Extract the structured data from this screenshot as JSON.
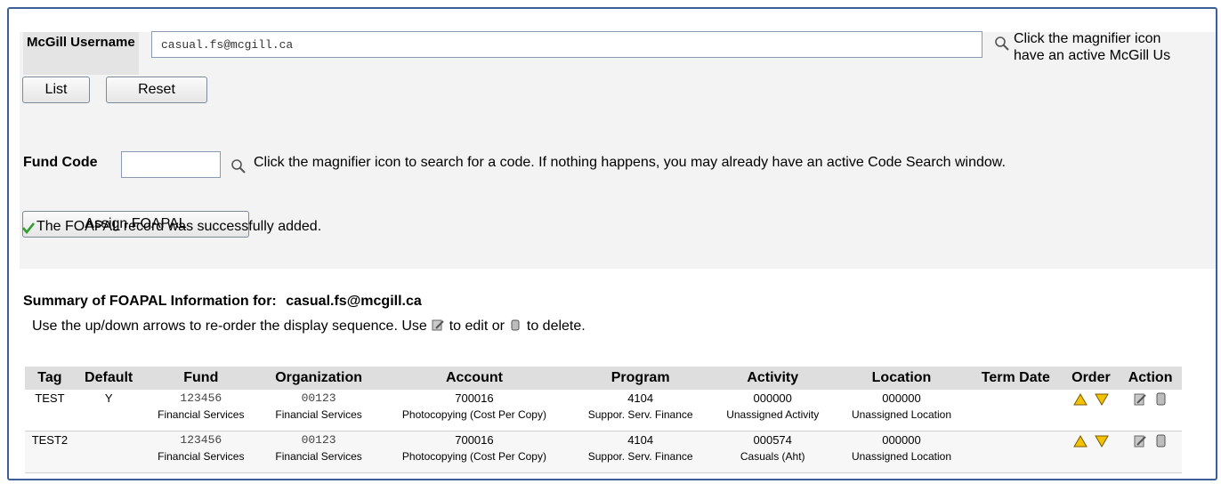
{
  "username": {
    "label": "McGill Username",
    "value": "casual.fs@mcgill.ca",
    "hint_line1": "Click the magnifier icon",
    "hint_line2": "have an active McGill Us",
    "list_button": "List",
    "reset_button": "Reset"
  },
  "fund_code": {
    "label": "Fund Code",
    "value": "",
    "hint": "Click the magnifier icon to search for a code. If nothing happens, you may already have an active Code Search window.",
    "assign_button": "Assign FOAPAL",
    "success_message": "The FOAPAL record was successfully added."
  },
  "summary": {
    "title_prefix": "Summary of FOAPAL Information for:",
    "user": "casual.fs@mcgill.ca",
    "instructions_a": "Use the up/down arrows to re-order the display sequence. Use",
    "instructions_b": "to edit or",
    "instructions_c": "to delete."
  },
  "table": {
    "headers": [
      "Tag",
      "Default",
      "Fund",
      "Organization",
      "Account",
      "Program",
      "Activity",
      "Location",
      "Term Date",
      "Order",
      "Action"
    ],
    "rows": [
      {
        "tag": "TEST",
        "default": "Y",
        "fund": "123456",
        "fund_desc": "Financial Services",
        "org": "00123",
        "org_desc": "Financial Services",
        "account": "700016",
        "account_desc": "Photocopying (Cost Per Copy)",
        "program": "4104",
        "program_desc": "Suppor. Serv. Finance",
        "activity": "000000",
        "activity_desc": "Unassigned Activity",
        "location": "000000",
        "location_desc": "Unassigned Location",
        "term_date": ""
      },
      {
        "tag": "TEST2",
        "default": "",
        "fund": "123456",
        "fund_desc": "Financial Services",
        "org": "00123",
        "org_desc": "Financial Services",
        "account": "700016",
        "account_desc": "Photocopying (Cost Per Copy)",
        "program": "4104",
        "program_desc": "Suppor. Serv. Finance",
        "activity": "000574",
        "activity_desc": "Casuals (Aht)",
        "location": "000000",
        "location_desc": "Unassigned Location",
        "term_date": ""
      }
    ]
  },
  "icons": {
    "magnifier": "magnifier-icon",
    "up_arrow": "arrow-up-icon",
    "down_arrow": "arrow-down-icon",
    "edit": "edit-icon",
    "delete": "delete-icon",
    "check": "check-icon"
  },
  "colors": {
    "frame_border": "#3b5f96",
    "arrow_fill": "#f2c200",
    "check": "#2e9e2e"
  }
}
